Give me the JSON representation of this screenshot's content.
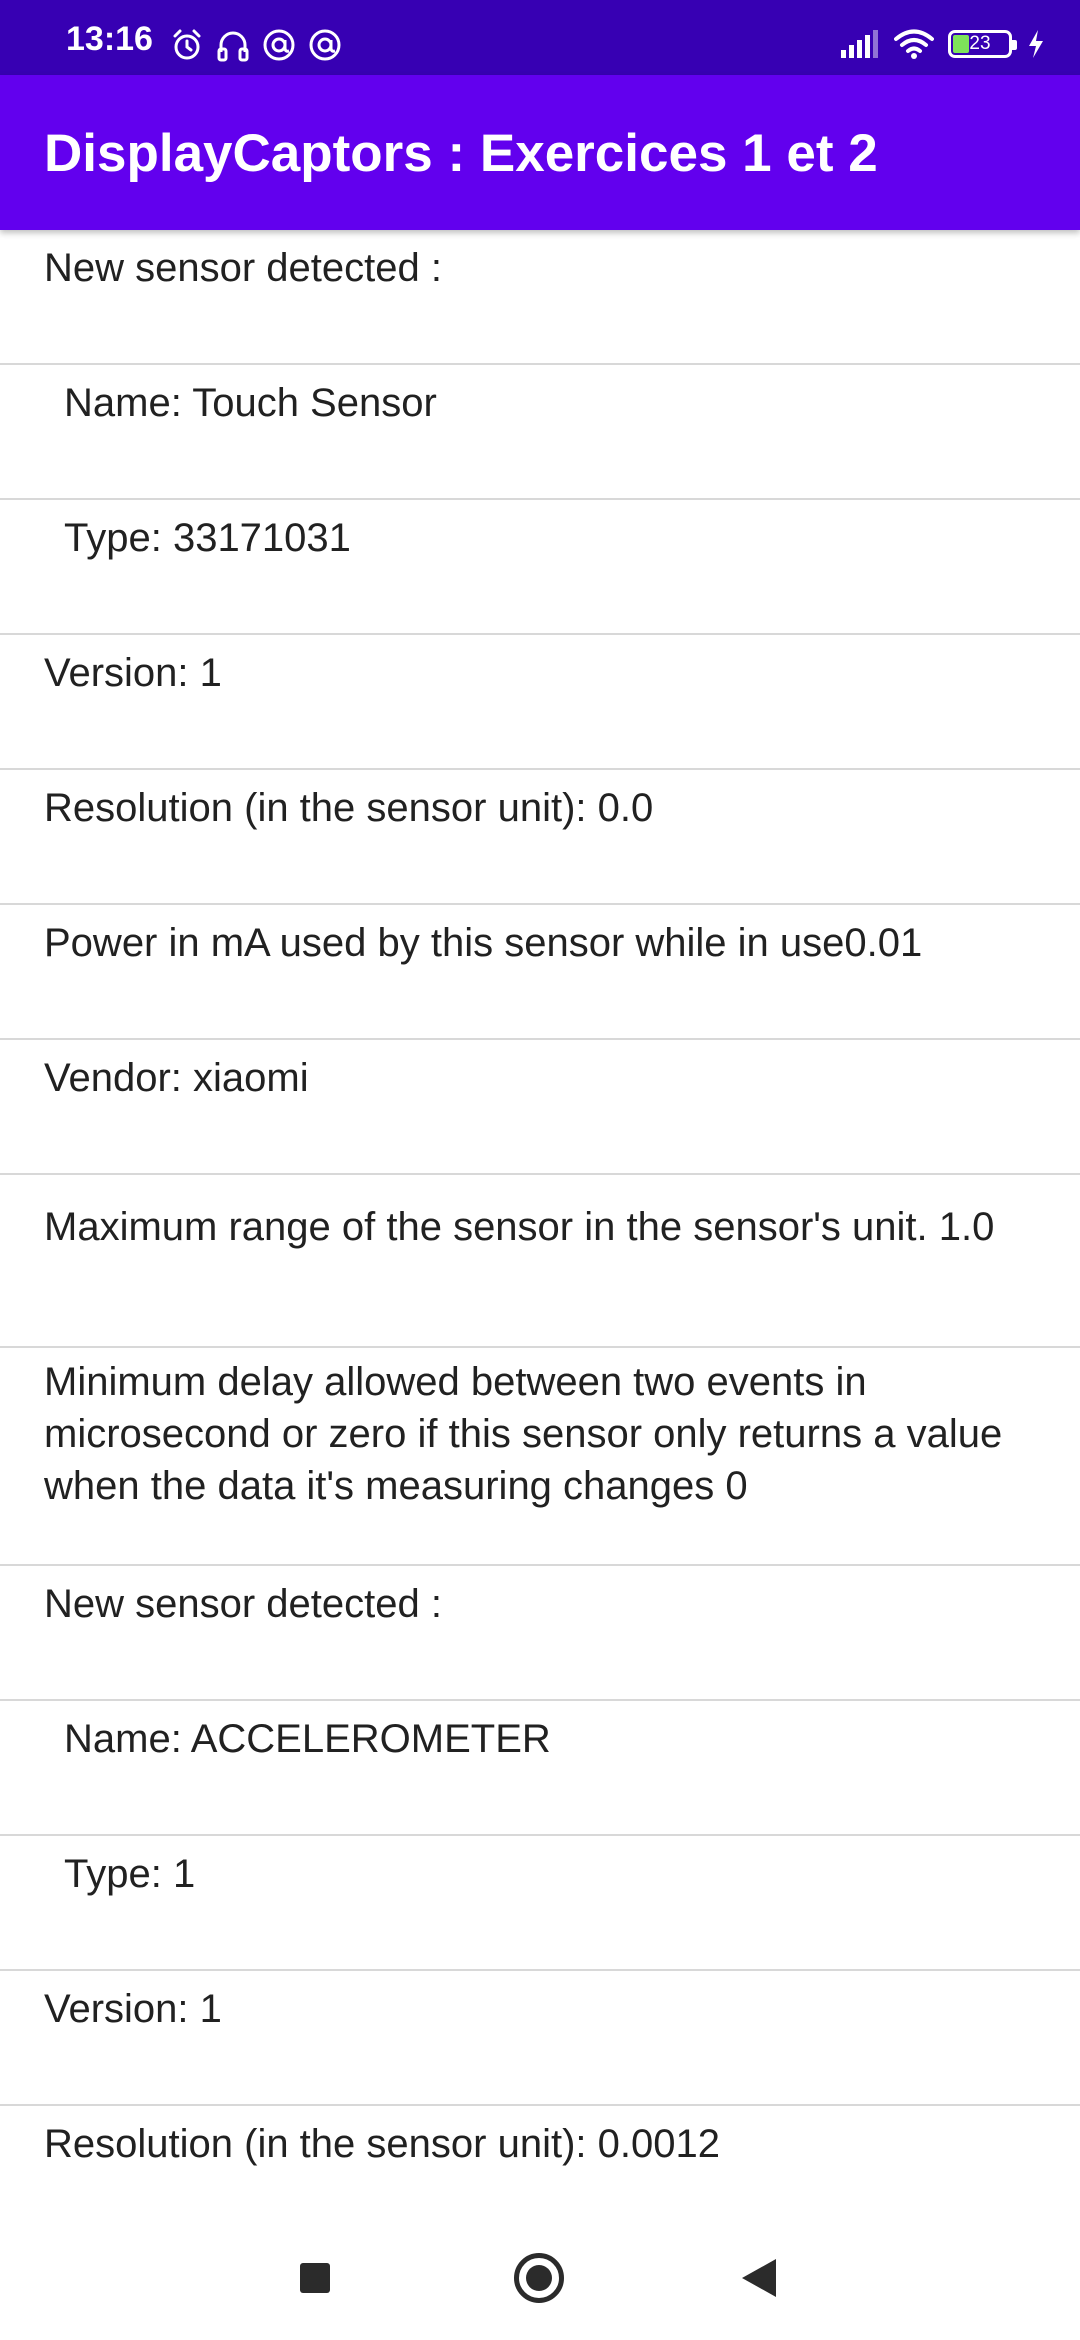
{
  "status_bar": {
    "time": "13:16",
    "battery_level": "23",
    "left_icons": [
      "alarm-icon",
      "headset-icon",
      "at-notification-icon",
      "at-notification-icon-2"
    ],
    "right_icons": [
      "signal-icon",
      "wifi-icon",
      "battery-icon",
      "charging-icon"
    ]
  },
  "app_bar": {
    "title": "DisplayCaptors : Exercices 1 et 2",
    "color": "#6200ee",
    "status_color": "#3700b3"
  },
  "list": {
    "items": [
      {
        "text": "New sensor detected :"
      },
      {
        "text": "Name: Touch Sensor"
      },
      {
        "text": "Type: 33171031"
      },
      {
        "text": "Version: 1"
      },
      {
        "text": "Resolution (in the sensor unit): 0.0"
      },
      {
        "text": "Power in mA used by this sensor while in use0.01"
      },
      {
        "text": "Vendor: xiaomi"
      },
      {
        "text": "Maximum range of the sensor in the sensor's unit. 1.0"
      },
      {
        "text": "Minimum delay allowed between two events in microsecond  or zero if this sensor only returns a value when the data it's measuring changes 0"
      },
      {
        "text": "New sensor detected :"
      },
      {
        "text": "Name: ACCELEROMETER"
      },
      {
        "text": "Type: 1"
      },
      {
        "text": "Version: 1"
      },
      {
        "text": "Resolution (in the sensor unit): 0.0012"
      }
    ]
  },
  "nav_bar": {
    "buttons": [
      "recents-button",
      "home-button",
      "back-button"
    ]
  }
}
